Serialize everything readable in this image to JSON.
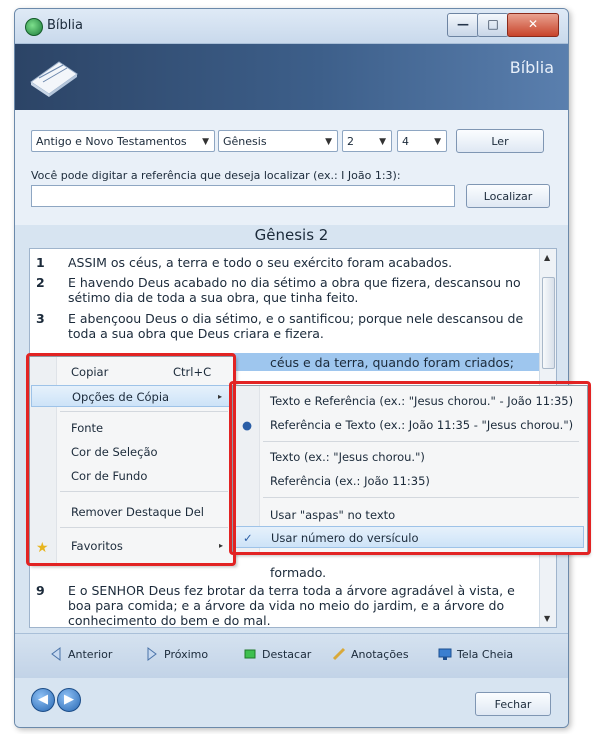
{
  "window": {
    "title": "Bíblia",
    "min_glyph": "—",
    "max_glyph": "□",
    "close_glyph": "✕"
  },
  "banner": {
    "title": "Bíblia"
  },
  "controls": {
    "testament": "Antigo e Novo Testamentos",
    "book": "Gênesis",
    "chapter": "2",
    "verse": "4",
    "read_button": "Ler",
    "hint": "Você pode digitar a referência que deseja localizar (ex.: I João 1:3):",
    "search_value": "",
    "find_button": "Localizar"
  },
  "chapter_title": "Gênesis 2",
  "verses": [
    {
      "num": "1",
      "text": "ASSIM os céus, a terra e todo o seu exército foram acabados."
    },
    {
      "num": "2",
      "text": "E havendo Deus acabado no dia sétimo a obra que fizera, descansou no sétimo dia de toda a sua obra, que tinha feito."
    },
    {
      "num": "3",
      "text": "E abençoou Deus o dia sétimo, e o santificou; porque nele descansou de toda a sua obra que Deus criara e fizera."
    },
    {
      "num": "",
      "text": "céus e da terra, quando foram criados;"
    },
    {
      "num": "",
      "text": "formado."
    },
    {
      "num": "9",
      "text": "E o SENHOR Deus fez brotar da terra toda a árvore agradável à vista, e boa para comida; e a árvore da vida no meio do jardim, e a árvore do conhecimento do bem e do mal."
    }
  ],
  "context_menu": {
    "copy": "Copiar",
    "copy_shortcut": "Ctrl+C",
    "copy_options": "Opções de Cópia",
    "font": "Fonte",
    "selection_color": "Cor de Seleção",
    "background_color": "Cor de Fundo",
    "remove_highlight": "Remover Destaque Del",
    "favorites": "Favoritos",
    "submenu_arrow": "▸"
  },
  "copy_options_menu": {
    "text_ref": "Texto e Referência (ex.: \"Jesus chorou.\" - João 11:35)",
    "ref_text": "Referência e Texto (ex.: João 11:35 - \"Jesus chorou.\")",
    "text_only": "Texto (ex.: \"Jesus chorou.\")",
    "ref_only": "Referência (ex.: João 11:35)",
    "use_quotes": "Usar \"aspas\" no texto",
    "use_verse_number": "Usar número do versículo",
    "radio_glyph": "●",
    "check_glyph": "✓"
  },
  "nav": {
    "previous": "Anterior",
    "next": "Próximo",
    "highlight": "Destacar",
    "notes": "Anotações",
    "fullscreen": "Tela Cheia"
  },
  "footer": {
    "close": "Fechar",
    "back_glyph": "◀",
    "forward_glyph": "▶"
  },
  "colors": {
    "accent": "#3d5f8a",
    "selection": "#9ec6ee",
    "annotation": "#e22323"
  }
}
